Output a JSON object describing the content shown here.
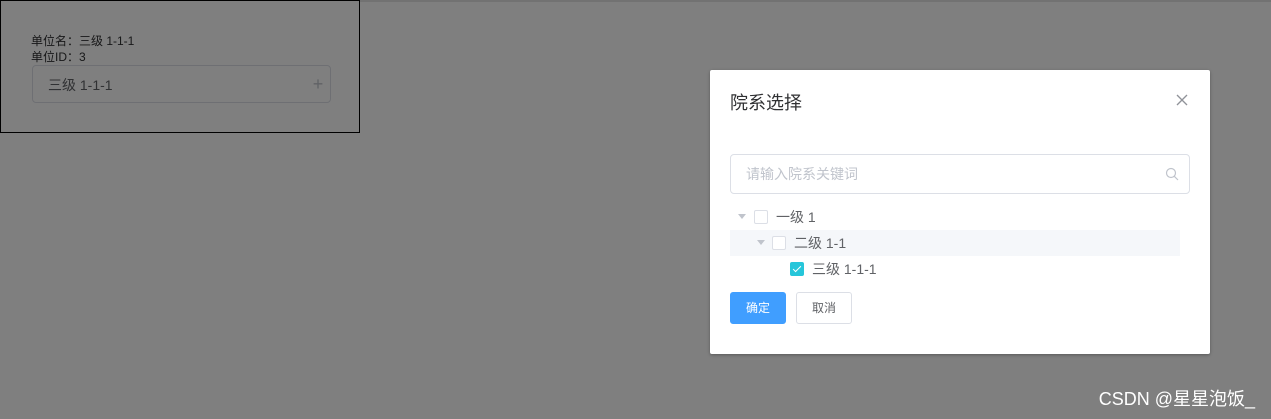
{
  "unit_panel": {
    "unit_name_line": "单位名：三级 1-1-1",
    "unit_id_line": "单位ID：3",
    "selected_value": "三级 1-1-1",
    "add_glyph": "+"
  },
  "dialog": {
    "title": "院系选择",
    "close_icon": "close-icon",
    "search": {
      "placeholder": "请输入院系关键词",
      "value": "",
      "icon": "search-icon"
    },
    "tree": [
      {
        "label": "一级 1",
        "checked": false,
        "expanded": true,
        "level": 1
      },
      {
        "label": "二级 1-1",
        "checked": false,
        "expanded": true,
        "level": 2,
        "highlighted": true
      },
      {
        "label": "三级 1-1-1",
        "checked": true,
        "level": 3
      }
    ],
    "confirm_label": "确定",
    "cancel_label": "取消"
  },
  "watermark": "CSDN @星星泡饭_",
  "colors": {
    "primary": "#409eff",
    "checkbox_checked": "#26c6da",
    "mask": "rgba(0,0,0,0.5)"
  }
}
